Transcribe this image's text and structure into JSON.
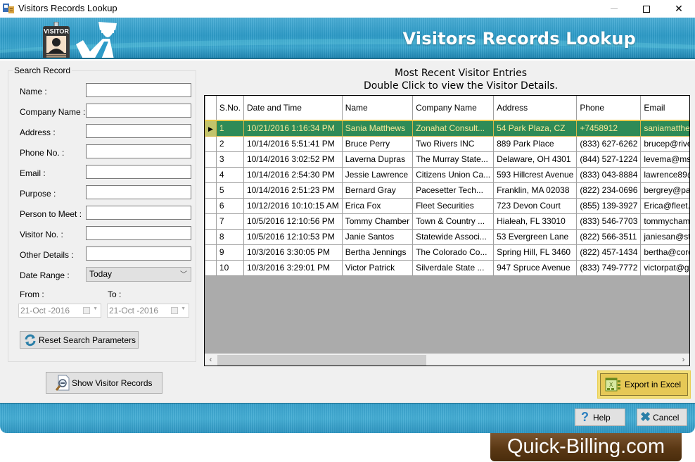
{
  "window": {
    "title": "Visitors Records Lookup",
    "controls": [
      "minimize",
      "maximize",
      "close"
    ]
  },
  "banner": {
    "title": "Visitors Records Lookup",
    "badge_text": "VISITOR"
  },
  "search": {
    "group_title": "Search Record",
    "fields": [
      {
        "label": "Name :",
        "value": ""
      },
      {
        "label": "Company Name :",
        "value": ""
      },
      {
        "label": "Address :",
        "value": ""
      },
      {
        "label": "Phone No. :",
        "value": ""
      },
      {
        "label": "Email :",
        "value": ""
      },
      {
        "label": "Purpose :",
        "value": ""
      },
      {
        "label": "Person to Meet :",
        "value": ""
      },
      {
        "label": "Visitor No. :",
        "value": ""
      },
      {
        "label": "Other Details :",
        "value": ""
      }
    ],
    "date_range_label": "Date Range :",
    "date_range_value": "Today",
    "from_label": "From :",
    "to_label": "To :",
    "from_value": "21-Oct -2016",
    "to_value": "21-Oct -2016",
    "reset_label": "Reset Search Parameters"
  },
  "show_records_label": "Show Visitor Records",
  "grid": {
    "title_line1": "Most Recent Visitor Entries",
    "title_line2": "Double Click to view the Visitor Details.",
    "columns": [
      "S.No.",
      "Date and Time",
      "Name",
      "Company Name",
      "Address",
      "Phone",
      "Email"
    ],
    "selected_row": 0,
    "rows": [
      [
        "1",
        "10/21/2016 1:16:34 PM",
        "Sania Matthews",
        "Zonahat Consult...",
        "54 Park Plaza, CZ",
        "+7458912",
        "saniamatthew"
      ],
      [
        "2",
        "10/14/2016 5:51:41 PM",
        "Bruce Perry",
        "Two Rivers INC",
        "889 Park Place",
        "(833) 627-6262",
        "brucep@rive"
      ],
      [
        "3",
        "10/14/2016 3:02:52 PM",
        "Laverna Dupras",
        "The Murray State...",
        "Delaware, OH 4301",
        "(844) 527-1224",
        "levema@msl"
      ],
      [
        "4",
        "10/14/2016 2:54:30 PM",
        "Jessie Lawrence",
        "Citizens Union Ca...",
        "593 Hillcrest Avenue",
        "(833) 043-8884",
        "lawrence89@"
      ],
      [
        "5",
        "10/14/2016 2:51:23 PM",
        "Bernard Gray",
        "Pacesetter Tech...",
        "Franklin, MA 02038",
        "(822) 234-0696",
        "bergrey@pac"
      ],
      [
        "6",
        "10/12/2016 10:10:15 AM",
        "Erica Fox",
        "Fleet Securities",
        "723 Devon Court",
        "(855) 139-3927",
        "Erica@fleet."
      ],
      [
        "7",
        "10/5/2016 12:10:56 PM",
        "Tommy Chamber",
        "Town & Country ...",
        "Hialeah, FL 33010",
        "(833) 546-7703",
        "tommycham@"
      ],
      [
        "8",
        "10/5/2016 12:10:53 PM",
        "Janie Santos",
        "Statewide Associ...",
        "53 Evergreen Lane",
        "(822) 566-3511",
        "janiesan@sta"
      ],
      [
        "9",
        "10/3/2016 3:30:05 PM",
        "Bertha Jennings",
        "The Colorado Co...",
        "Spring Hill, FL 3460",
        "(822) 457-1434",
        "bertha@cord"
      ],
      [
        "10",
        "10/3/2016 3:29:01 PM",
        "Victor Patrick",
        "Silverdale State ...",
        "947 Spruce Avenue",
        "(833) 749-7772",
        "victorpat@gr"
      ]
    ]
  },
  "export_label": "Export in Excel",
  "help_label": "Help",
  "cancel_label": "Cancel",
  "brand_text": "Quick-Billing.com",
  "colors": {
    "banner": "#2d9bc8",
    "selected_row": "#2e8b57",
    "selected_text": "#f7e99a",
    "export_highlight": "#e6c856",
    "brand_bg": "#5a3814"
  }
}
